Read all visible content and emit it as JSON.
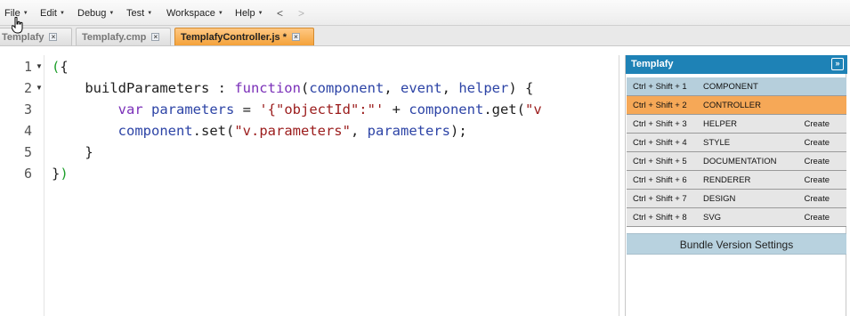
{
  "menubar": {
    "items": [
      "File",
      "Edit",
      "Debug",
      "Test",
      "Workspace",
      "Help"
    ],
    "back_icon": "<",
    "forward_icon": ">"
  },
  "tabs": [
    {
      "label": "Templafy",
      "active": false
    },
    {
      "label": "Templafy.cmp",
      "active": false
    },
    {
      "label": "TemplafyController.js *",
      "active": true
    }
  ],
  "editor": {
    "line_numbers": [
      "1",
      "2",
      "3",
      "4",
      "5",
      "6"
    ]
  },
  "panel": {
    "title": "Templafy",
    "collapse_icon": "»",
    "rows": [
      {
        "shortcut": "Ctrl + Shift + 1",
        "label": "COMPONENT",
        "action": "",
        "state": "current"
      },
      {
        "shortcut": "Ctrl + Shift + 2",
        "label": "CONTROLLER",
        "action": "",
        "state": "selected"
      },
      {
        "shortcut": "Ctrl + Shift + 3",
        "label": "HELPER",
        "action": "Create",
        "state": "normal"
      },
      {
        "shortcut": "Ctrl + Shift + 4",
        "label": "STYLE",
        "action": "Create",
        "state": "normal"
      },
      {
        "shortcut": "Ctrl + Shift + 5",
        "label": "DOCUMENTATION",
        "action": "Create",
        "state": "normal"
      },
      {
        "shortcut": "Ctrl + Shift + 6",
        "label": "RENDERER",
        "action": "Create",
        "state": "normal"
      },
      {
        "shortcut": "Ctrl + Shift + 7",
        "label": "DESIGN",
        "action": "Create",
        "state": "normal"
      },
      {
        "shortcut": "Ctrl + Shift + 8",
        "label": "SVG",
        "action": "Create",
        "state": "normal"
      }
    ],
    "bundle_button": "Bundle Version Settings"
  },
  "icons": [
    "chevron-down-icon",
    "back-arrow-icon",
    "forward-arrow-icon",
    "close-icon",
    "fold-icon",
    "double-chevron-right-icon",
    "hand-cursor-icon"
  ],
  "colors": {
    "panel_header": "#1e82b6",
    "active_tab": "#f4a23a",
    "selected_row": "#f6a857",
    "current_row": "#b6cfdc",
    "keyword": "#7a2fb8",
    "param": "#2d44a6",
    "string": "#9b1c1c",
    "bracket": "#1d9e2a"
  }
}
